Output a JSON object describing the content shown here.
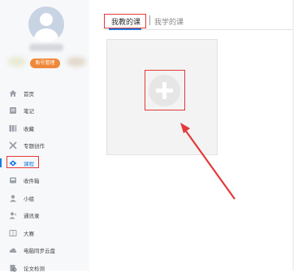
{
  "sidebar": {
    "account_badge": "账号管理",
    "items": [
      {
        "label": "首页",
        "icon": "home-icon"
      },
      {
        "label": "笔记",
        "icon": "note-icon"
      },
      {
        "label": "收藏",
        "icon": "bookmark-icon"
      },
      {
        "label": "专题创作",
        "icon": "tools-icon"
      },
      {
        "label": "课程",
        "icon": "course-icon"
      },
      {
        "label": "收件箱",
        "icon": "inbox-icon"
      },
      {
        "label": "小组",
        "icon": "user-icon"
      },
      {
        "label": "通讯录",
        "icon": "contacts-icon"
      },
      {
        "label": "大赛",
        "icon": "contest-icon"
      },
      {
        "label": "电脑同步云盘",
        "icon": "cloud-icon"
      },
      {
        "label": "论文检测",
        "icon": "paper-check-icon"
      }
    ]
  },
  "tabs": {
    "mine": "我教的课",
    "learn": "我学的课"
  },
  "colors": {
    "accent": "#1a7be0",
    "highlight_red": "#e23a3a",
    "badge_orange": "#f0883a"
  }
}
